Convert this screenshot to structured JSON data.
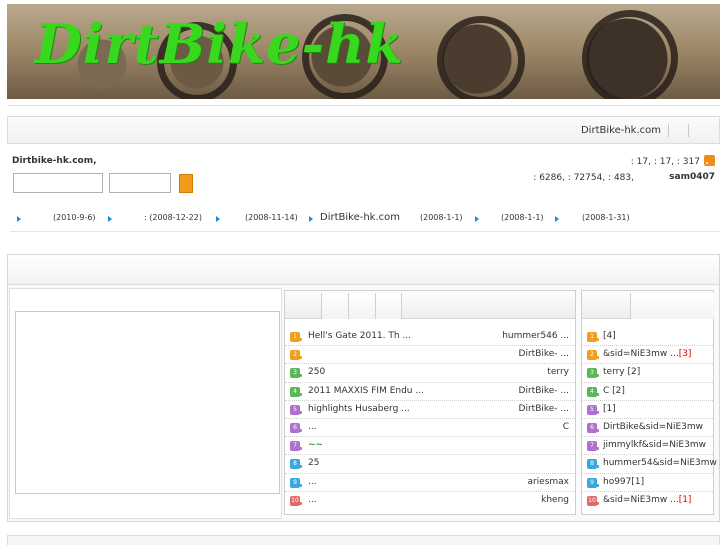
{
  "banner": {
    "logo_text": "DirtBike-hk"
  },
  "navbar": {
    "site_link": "DirtBike-hk.com"
  },
  "userbar": {
    "welcome": "Dirtbike-hk.com,",
    "stats_line1": ": 17,   : 17,   : 317",
    "stats_line2": ": 6286,  : 72754,  : 483,",
    "username": "sam0407"
  },
  "announcements": [
    {
      "text": "(2010-9-6)"
    },
    {
      "text": ":  (2008-12-22)"
    },
    {
      "text": "(2008-11-14)"
    },
    {
      "text": "DirtBike-hk.com"
    },
    {
      "text": "(2008-1-1)"
    },
    {
      "text": "(2008-1-1)"
    },
    {
      "text": "(2008-1-31)"
    }
  ],
  "colors": {
    "accent_orange": "#f39a1a",
    "logo_green": "#37d81d",
    "link_blue": "#1a8fd6",
    "highlight_red": "#dd0000",
    "rank_colors": [
      "#f0a020",
      "#f0a020",
      "#5ab85a",
      "#5ab85a",
      "#b070d0",
      "#b070d0",
      "#b070d0",
      "#3aa8e0",
      "#3aa8e0",
      "#e06a6a",
      "#e06a6a"
    ]
  },
  "hot_threads": [
    {
      "rank": "1",
      "title": "Hell's Gate 2011. Th ...",
      "author": "hummer546 ..."
    },
    {
      "rank": "2",
      "title": "",
      "author": "DirtBike- ..."
    },
    {
      "rank": "3",
      "title": "250",
      "author": "terry"
    },
    {
      "rank": "4",
      "title": "2011 MAXXIS FIM Endu ...",
      "author": "DirtBike- ..."
    },
    {
      "rank": "5",
      "title": "highlights Husaberg ...",
      "author": "DirtBike- ..."
    },
    {
      "rank": "6",
      "title": "  ...",
      "author": "C"
    },
    {
      "rank": "7",
      "title": "  ~~",
      "author": ""
    },
    {
      "rank": "8",
      "title": "25",
      "author": ""
    },
    {
      "rank": "9",
      "title": "     ...",
      "author": "ariesmax"
    },
    {
      "rank": "10",
      "title": "       ...",
      "author": "kheng"
    }
  ],
  "top_posters": [
    {
      "rank": "1",
      "name": "   [4]",
      "suffix": ""
    },
    {
      "rank": "2",
      "name": "    &sid=NiE3mw ...",
      "suffix": "[3]"
    },
    {
      "rank": "3",
      "name": "terry [2]",
      "suffix": ""
    },
    {
      "rank": "4",
      "name": "C [2]",
      "suffix": ""
    },
    {
      "rank": "5",
      "name": "   [1]",
      "suffix": ""
    },
    {
      "rank": "6",
      "name": "DirtBike&sid=NiE3mw",
      "suffix": ""
    },
    {
      "rank": "7",
      "name": "jimmylkf&sid=NiE3mw",
      "suffix": ""
    },
    {
      "rank": "8",
      "name": "hummer54&sid=NiE3mw",
      "suffix": ""
    },
    {
      "rank": "9",
      "name": "ho997[1]",
      "suffix": ""
    },
    {
      "rank": "10",
      "name": "    &sid=NiE3mw ...",
      "suffix": "[1]"
    }
  ]
}
